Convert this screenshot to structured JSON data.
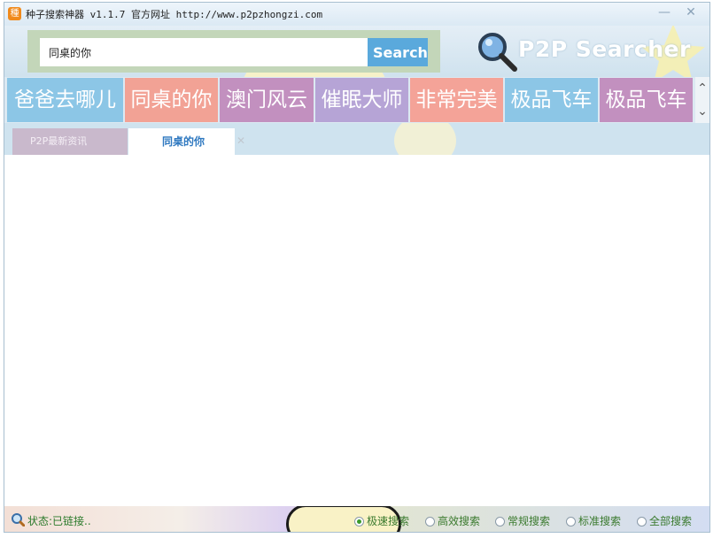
{
  "window": {
    "title": "种子搜索神器 v1.1.7 官方网址 http://www.p2pzhongzi.com",
    "minimize_glyph": "—",
    "close_glyph": "✕"
  },
  "search": {
    "value": "同桌的你",
    "button_label": "Search"
  },
  "brand": {
    "name": "P2P Searcher",
    "icon": "magnifier-icon"
  },
  "hot_tiles": [
    {
      "label": "爸爸去哪儿",
      "color": "#8cc6e6"
    },
    {
      "label": "同桌的你",
      "color": "#f2a295"
    },
    {
      "label": "澳门风云",
      "color": "#c290bf"
    },
    {
      "label": "催眠大师",
      "color": "#b6a4d6"
    },
    {
      "label": "非常完美",
      "color": "#f4a398"
    },
    {
      "label": "极品飞车",
      "color": "#8cc6e6"
    },
    {
      "label": "极品飞车",
      "color": "#c290bf"
    }
  ],
  "scroll": {
    "up": "⌃",
    "down": "⌄"
  },
  "tabs": {
    "news_label": "P2P最新资讯",
    "active_label": "同桌的你",
    "close_glyph": "✕"
  },
  "status": {
    "text": "状态:已链接..",
    "options": [
      {
        "label": "极速搜索",
        "selected": true
      },
      {
        "label": "高效搜索",
        "selected": false
      },
      {
        "label": "常规搜索",
        "selected": false
      },
      {
        "label": "标准搜索",
        "selected": false
      },
      {
        "label": "全部搜索",
        "selected": false
      }
    ]
  }
}
